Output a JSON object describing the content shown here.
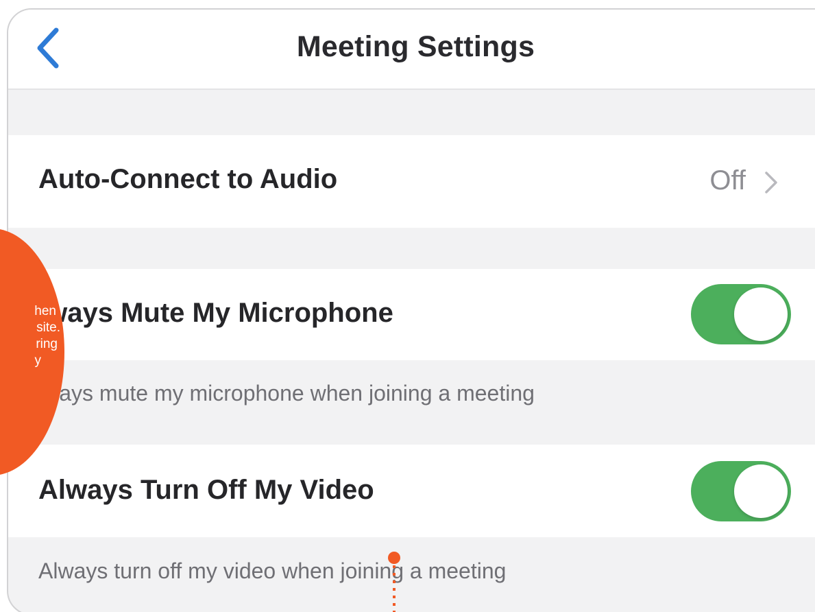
{
  "header": {
    "title": "Meeting Settings",
    "back_icon": "chevron-left-icon"
  },
  "settings": {
    "auto_connect": {
      "label": "Auto-Connect to Audio",
      "value": "Off",
      "icon": "chevron-right-icon"
    },
    "mute_microphone": {
      "label": "lways Mute My Microphone",
      "enabled": true,
      "description": "lways mute my microphone when joining a meeting"
    },
    "turn_off_video": {
      "label": "Always Turn Off My Video",
      "enabled": true,
      "description": "Always turn off my video when joining a meeting"
    }
  },
  "callout": {
    "lines": [
      "",
      "hen",
      "site.",
      "ring",
      "y"
    ]
  },
  "colors": {
    "accent_blue": "#2e7bd6",
    "toggle_on": "#4caf5c",
    "callout_orange": "#f15a24"
  }
}
